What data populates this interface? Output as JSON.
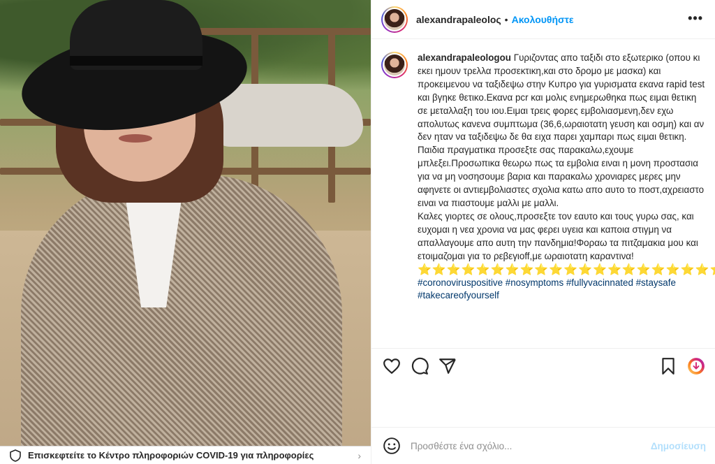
{
  "post": {
    "username": "alexandrapaleoloς",
    "follow_label": "Ακολουθήστε",
    "more_label": "•••"
  },
  "caption": {
    "username": "alexandrapaleologou",
    "paragraphs": [
      "Γυριζοντας απο ταξιδι στο εξωτερικο (οπου κι εκει ημουν τρελλα προσεκτικη,και στο δρομο με μασκα) και προκειμενου να ταξιδεψω στην Κυπρο για γυρισματα εκανα rapid test και βγηκε θετικο.Εκανα pcr και μολις ενημερωθηκα πως ειμαι θετικη σε μεταλλαξη του ιου.Ειμαι τρεις φορες εμβολιασμενη,δεν εχω απολυτως κανενα συμπτωμα (36,6,ωραιοτατη γευση και οσμη) και αν δεν ηταν να ταξιδεψω δε θα ειχα παρει χαμπαρι πως ειμαι θετικη.",
      "Παιδια πραγματικα προσεξτε σας παρακαλω,εχουμε μπλεξει.Προσωπικα θεωρω πως τα εμβολια ειναι η μονη προστασια για να μη νοσησουμε βαρια και παρακαλω χρονιαρες μερες μην αφηνετε οι αντιεμβολιαστες σχολια κατω απο αυτο το ποστ,αχρειαστο ειναι να πιαστουμε μαλλι με μαλλι.",
      "Καλες γιορτες σε ολους,προσεξτε τον εαυτο και τους γυρω σας, και ευχομαι η νεα χρονια να μας φερει υγεια και καποια στιγμη να απαλλαγουμε απο αυτη την πανδημια!Φοραω τα πιτζαμακια μου και ετοιμαζομαι για το ρεβεγιοff,με ωραιοτατη καραντινα!"
    ],
    "stars": "⭐⭐⭐⭐⭐⭐⭐⭐⭐⭐⭐⭐⭐⭐⭐⭐⭐⭐⭐⭐⭐⭐⭐⭐⭐⭐⭐",
    "hashtags": "#coronoviruspositive #nosymptoms #fullyvacinnated #staysafe #takecareofyourself"
  },
  "actions": {
    "like": "heart-icon",
    "comment": "comment-icon",
    "share": "share-icon",
    "save": "bookmark-icon",
    "download": "download-icon"
  },
  "comment_box": {
    "placeholder": "Προσθέστε ένα σχόλιο...",
    "publish_label": "Δημοσίευση"
  },
  "covid_banner": {
    "text": "Επισκεφτείτε το Κέντρο πληροφοριών COVID-19 για πληροφορίες"
  },
  "colors": {
    "link_blue": "#0095f6",
    "hashtag_blue": "#00376b",
    "publish_disabled": "#b2dffc",
    "star_yellow": "#f5c518"
  }
}
